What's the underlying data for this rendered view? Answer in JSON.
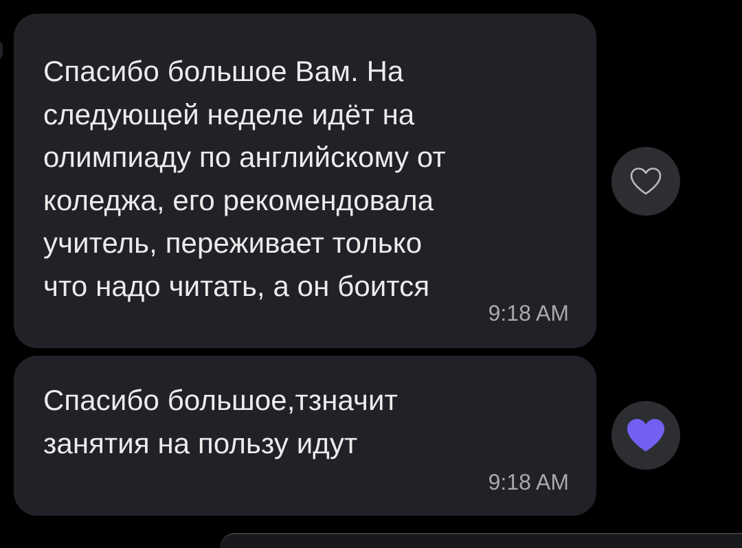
{
  "messages": [
    {
      "text": "Спасибо большое Вам. На\nследующей неделе идёт на\nолимпиаду по английскому от\nколеджа, его рекомендовала\nучитель, переживает только\nчто надо читать, а он боится",
      "time": "9:18 AM",
      "reaction": {
        "icon": "heart-outline-icon",
        "liked": false
      }
    },
    {
      "text": "Спасибо большое,тзначит\nзанятия на пользу идут",
      "time": "9:18 AM",
      "reaction": {
        "icon": "heart-filled-icon",
        "liked": true
      }
    }
  ],
  "colors": {
    "background": "#000000",
    "bubble": "#202227",
    "text": "#ececec",
    "timestamp": "#a9a9ae",
    "reaction_button": "#2d2e32",
    "heart_accent": "#7360f2"
  }
}
